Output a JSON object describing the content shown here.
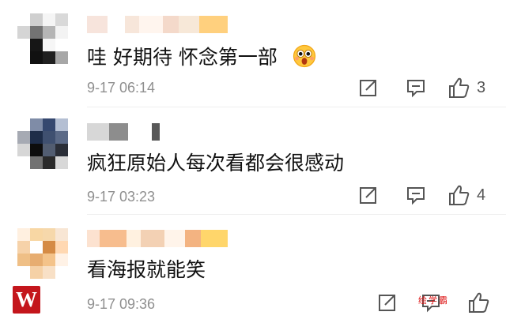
{
  "comments": [
    {
      "text": "哇 好期待 怀念第一部",
      "timestamp": "9-17 06:14",
      "like_count": "3",
      "emoji_icon": "surprised-face-emoji"
    },
    {
      "text": "疯狂原始人每次看都会很感动",
      "timestamp": "9-17 03:23",
      "like_count": "4"
    },
    {
      "text": "看海报就能笑",
      "timestamp": "9-17 09:36",
      "like_count": ""
    }
  ],
  "watermark": {
    "logo_letter": "W",
    "site_text": "绘学霸"
  },
  "icons": {
    "share": "share-icon",
    "reply": "comment-icon",
    "like": "thumbs-up-icon"
  },
  "colors": {
    "text": "#111111",
    "meta": "#8f8f8f",
    "icon": "#555555",
    "watermark": "#c4161c"
  }
}
